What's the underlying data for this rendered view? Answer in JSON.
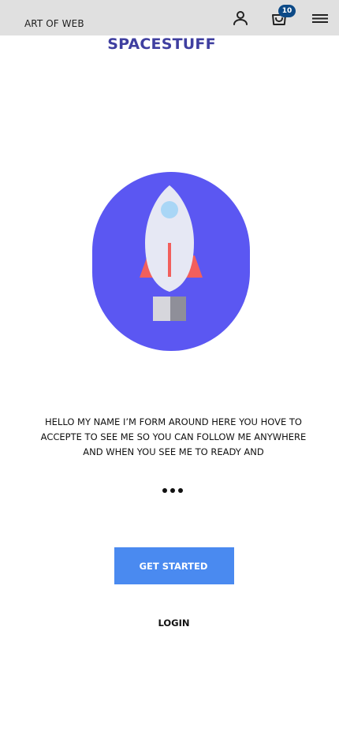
{
  "header": {
    "brand_text": "ART OF WEB",
    "cart_count": "10",
    "icons": [
      "person-icon",
      "shopping-bag-icon",
      "menu-icon"
    ]
  },
  "main": {
    "title": "SPACESTUFF",
    "description": "HELLO MY NAME I’M FORM AROUND HERE YOU HOVE TO ACCEPTE TO SEE ME SO YOU CAN FOLLOW ME ANYWHERE AND WHEN YOU SEE ME TO READY AND",
    "ellipsis_dots": 3,
    "primary_button": "GET STARTED",
    "secondary_link": "LOGIN"
  },
  "colors": {
    "topbar": "#e0e0e0",
    "title": "#3f3fa0",
    "hero_circle": "#5b57f2",
    "cta_button": "#4a8af0",
    "badge": "#0d4a87"
  }
}
